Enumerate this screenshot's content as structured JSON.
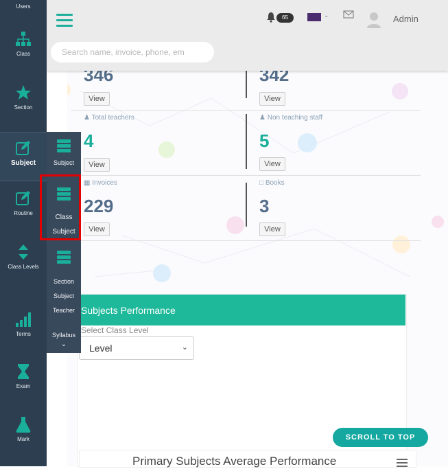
{
  "header": {
    "search_placeholder": "Search name, invoice, phone, em",
    "notification_count": "65",
    "user_name": "Admin"
  },
  "sidebar": {
    "items": [
      {
        "label": "Users"
      },
      {
        "label": "Class"
      },
      {
        "label": "Section"
      },
      {
        "label": "Subject"
      },
      {
        "label": "Routine"
      },
      {
        "label": "Class Levels"
      },
      {
        "label": "Terms"
      },
      {
        "label": "Exam"
      },
      {
        "label": "Mark"
      }
    ]
  },
  "submenu": {
    "items": [
      {
        "label": "Subject"
      },
      {
        "label": "Class",
        "label2": "Subject"
      },
      {
        "label": "Section",
        "label2": "Subject",
        "label3": "Teacher"
      },
      {
        "label": "Syllabus"
      }
    ]
  },
  "stats": {
    "top_left_value": "346",
    "top_right_value": "342",
    "total_teachers_label": "Total teachers",
    "total_teachers_value": "4",
    "non_teaching_label": "Non teaching staff",
    "non_teaching_value": "5",
    "invoices_label": "Invoices",
    "invoices_value": "229",
    "books_label": "Books",
    "books_value": "3",
    "view_label": "View"
  },
  "performance": {
    "title": "Subjects Performance",
    "select_label": "Select Class Level",
    "select_value": "Level",
    "chart_title": "Primary Subjects Average Performance"
  },
  "scroll_top_label": "SCROLL TO TOP",
  "colors": {
    "sidebar_bg": "#2c3e50",
    "accent": "#1eb89a",
    "highlight": "#e30000"
  }
}
